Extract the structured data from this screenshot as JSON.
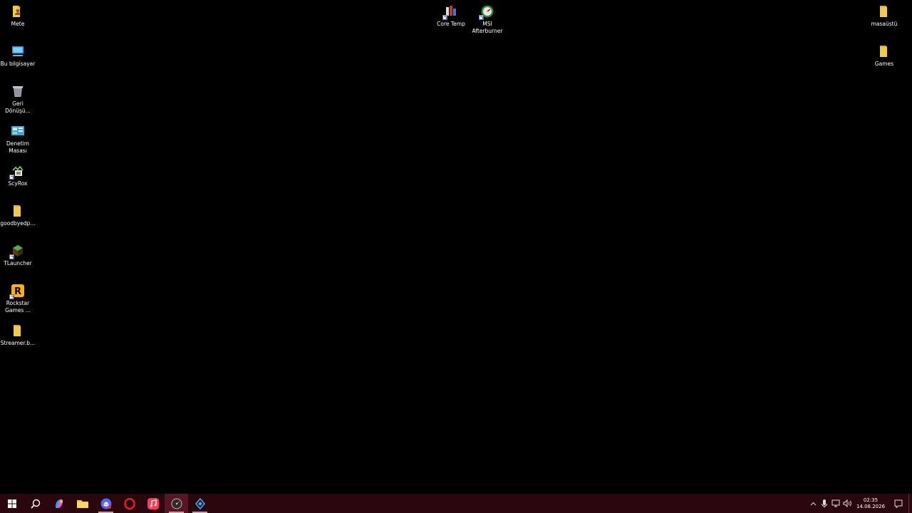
{
  "desktop": {
    "icons_left": [
      {
        "label": "Mete",
        "icon": "folder-user-icon"
      },
      {
        "label": "Bu bilgisayar",
        "icon": "computer-icon"
      },
      {
        "label": "Geri Dönüşü...",
        "icon": "recycle-bin-icon"
      },
      {
        "label": "Denetim Masası",
        "icon": "control-panel-icon"
      },
      {
        "label": "ScyRox",
        "icon": "scyrox-icon"
      },
      {
        "label": "goodbyedp...",
        "icon": "folder-icon"
      },
      {
        "label": "TLauncher",
        "icon": "tlauncher-icon"
      },
      {
        "label": "Rockstar Games ...",
        "icon": "rockstar-icon"
      },
      {
        "label": "Streamer.b...",
        "icon": "folder-icon"
      }
    ],
    "icons_top": [
      {
        "label": "Core Temp",
        "icon": "core-temp-icon"
      },
      {
        "label": "MSI Afterburner",
        "icon": "msi-afterburner-icon"
      }
    ],
    "icons_right": [
      {
        "label": "masaüstü",
        "icon": "folder-icon"
      },
      {
        "label": "Games",
        "icon": "folder-icon"
      }
    ]
  },
  "taskbar": {
    "apps": [
      {
        "name": "start",
        "icon": "windows-start-icon"
      },
      {
        "name": "search",
        "icon": "search-icon"
      },
      {
        "name": "copilot",
        "icon": "copilot-icon"
      },
      {
        "name": "file-explorer",
        "icon": "folder-icon"
      },
      {
        "name": "discord",
        "icon": "discord-icon"
      },
      {
        "name": "opera",
        "icon": "opera-icon"
      },
      {
        "name": "music",
        "icon": "music-icon"
      },
      {
        "name": "clock-app",
        "icon": "gauge-icon"
      },
      {
        "name": "app-last",
        "icon": "diamond-icon"
      }
    ],
    "tray": {
      "time": "02:35",
      "date": "14.08.2026"
    }
  },
  "colors": {
    "taskbar": "#2a070c",
    "folder": "#f2c94c",
    "accent": "#5a1522"
  }
}
